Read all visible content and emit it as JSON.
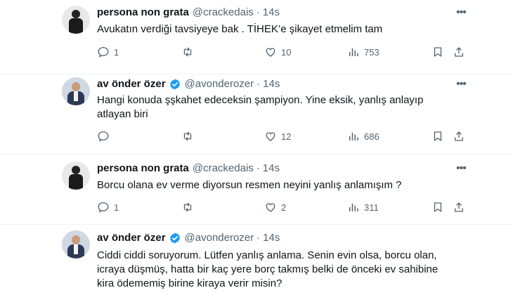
{
  "colors": {
    "text": "#0f1419",
    "secondary": "#536471",
    "verified": "#1d9bf0",
    "divider": "#eff3f4"
  },
  "tweets": [
    {
      "name": "persona non grata",
      "handle": "@crackedais",
      "dot": "·",
      "time": "14s",
      "verified": false,
      "avatar": "dark-figure-avatar",
      "text": "Avukatın verdiği tavsiyeye bak . TİHEK’e şikayet etmelim tam",
      "replies": "1",
      "retweets": "",
      "likes": "10",
      "views": "753"
    },
    {
      "name": "av önder özer",
      "handle": "@avonderozer",
      "dot": "·",
      "time": "14s",
      "verified": true,
      "avatar": "lawyer-avatar",
      "text_lines": [
        "Hangi konuda şşkahet edeceksin şampiyon. Yine eksik, yanlış anlayıp",
        "atlayan biri"
      ],
      "replies": "",
      "retweets": "",
      "likes": "12",
      "views": "686"
    },
    {
      "name": "persona non grata",
      "handle": "@crackedais",
      "dot": "·",
      "time": "14s",
      "verified": false,
      "avatar": "dark-figure-avatar",
      "text": "Borcu olana ev verme diyorsun resmen neyini yanlış anlamışım ?",
      "replies": "1",
      "retweets": "",
      "likes": "2",
      "views": "311"
    },
    {
      "name": "av önder özer",
      "handle": "@avonderozer",
      "dot": "·",
      "time": "14s",
      "verified": true,
      "avatar": "lawyer-avatar",
      "text_lines": [
        "Ciddi ciddi soruyorum. Lütfen yanlış anlama.  Senin evin olsa, borcu olan,",
        "icraya düşmüş, hatta bir kaç yere borç takmış belki de önceki ev sahibine",
        "kira ödememiş birine kiraya verir misin?"
      ]
    }
  ]
}
